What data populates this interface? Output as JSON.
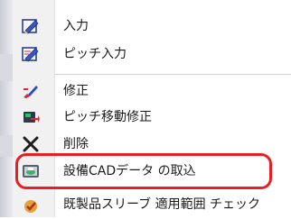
{
  "menu": {
    "items": [
      {
        "label": "入力",
        "icon": "pencil-edit-icon"
      },
      {
        "label": "ピッチ入力",
        "icon": "pitch-pencil-icon"
      },
      {
        "label": "修正",
        "icon": "brush-edit-icon"
      },
      {
        "label": "ピッチ移動修正",
        "icon": "pitch-move-icon"
      },
      {
        "label": "削除",
        "icon": "delete-x-icon"
      },
      {
        "label": "設備CADデータ の取込",
        "icon": "cad-import-icon"
      },
      {
        "label": "既製品スリーブ 適用範囲 チェック",
        "icon": "sleeve-check-icon"
      }
    ]
  },
  "highlight": {
    "color": "#e81e23"
  }
}
